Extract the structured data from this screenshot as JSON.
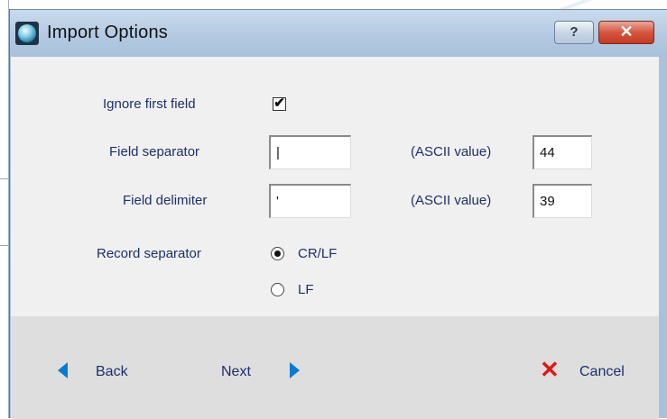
{
  "window": {
    "title": "Import Options",
    "help_label": "?",
    "close_label": "✕"
  },
  "form": {
    "ignore_first_field": {
      "label": "Ignore first field",
      "checked": true,
      "mark": "✔"
    },
    "field_separator": {
      "label": "Field separator",
      "value": "|",
      "ascii_label": "(ASCII value)",
      "ascii_value": "44"
    },
    "field_delimiter": {
      "label": "Field delimiter",
      "value": "'",
      "ascii_label": "(ASCII value)",
      "ascii_value": "39"
    },
    "record_separator": {
      "label": "Record separator",
      "options": [
        {
          "label": "CR/LF",
          "selected": true
        },
        {
          "label": "LF",
          "selected": false
        }
      ]
    }
  },
  "footer": {
    "back_label": "Back",
    "next_label": "Next",
    "cancel_label": "Cancel",
    "cancel_icon": "✕"
  },
  "colors": {
    "label_text": "#1c2f6b",
    "arrow": "#0a7ad1",
    "cancel_x": "#e01818",
    "close_button": "#d6553f"
  }
}
